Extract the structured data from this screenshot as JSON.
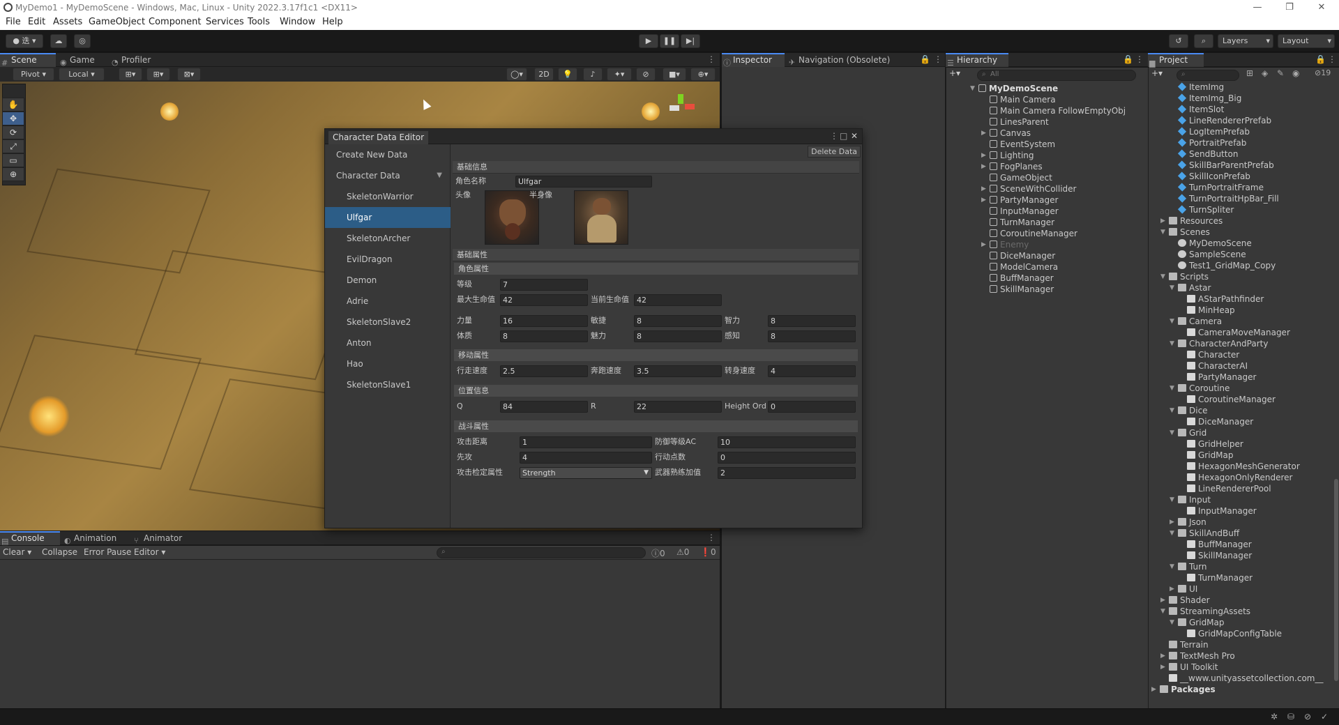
{
  "window": {
    "title": "MyDemo1 - MyDemoScene - Windows, Mac, Linux - Unity 2022.3.17f1c1 <DX11>"
  },
  "menu": [
    "File",
    "Edit",
    "Assets",
    "GameObject",
    "Component",
    "Services",
    "Tools",
    "Window",
    "Help"
  ],
  "toolbar": {
    "account_label": "迭",
    "layers_label": "Layers",
    "layout_label": "Layout"
  },
  "scene_tabs": [
    {
      "label": "Scene"
    },
    {
      "label": "Game"
    },
    {
      "label": "Profiler"
    }
  ],
  "scene_tools": {
    "pivot_label": "Pivot",
    "local_label": "Local",
    "mode_2d": "2D"
  },
  "inspector_tabs": [
    {
      "label": "Inspector"
    },
    {
      "label": "Navigation (Obsolete)"
    }
  ],
  "hierarchy": {
    "tab_label": "Hierarchy",
    "search_placeholder": "All",
    "scene": "MyDemoScene",
    "items": [
      {
        "label": "Main Camera",
        "expandable": false
      },
      {
        "label": "Main Camera FollowEmptyObj",
        "expandable": false
      },
      {
        "label": "LinesParent",
        "expandable": false
      },
      {
        "label": "Canvas",
        "expandable": true
      },
      {
        "label": "EventSystem",
        "expandable": false
      },
      {
        "label": "Lighting",
        "expandable": true
      },
      {
        "label": "FogPlanes",
        "expandable": true
      },
      {
        "label": "GameObject",
        "expandable": false
      },
      {
        "label": "SceneWithCollider",
        "expandable": true
      },
      {
        "label": "PartyManager",
        "expandable": true
      },
      {
        "label": "InputManager",
        "expandable": false
      },
      {
        "label": "TurnManager",
        "expandable": false
      },
      {
        "label": "CoroutineManager",
        "expandable": false
      },
      {
        "label": "Enemy",
        "expandable": true,
        "disabled": true
      },
      {
        "label": "DiceManager",
        "expandable": false
      },
      {
        "label": "ModelCamera",
        "expandable": false
      },
      {
        "label": "BuffManager",
        "expandable": false
      },
      {
        "label": "SkillManager",
        "expandable": false
      }
    ]
  },
  "project": {
    "tab_label": "Project",
    "hidden_count": "19",
    "items": [
      {
        "label": "ItemImg",
        "type": "prefab",
        "indent": 2
      },
      {
        "label": "ItemImg_Big",
        "type": "prefab",
        "indent": 2
      },
      {
        "label": "ItemSlot",
        "type": "prefab",
        "indent": 2
      },
      {
        "label": "LineRendererPrefab",
        "type": "prefab",
        "indent": 2
      },
      {
        "label": "LogItemPrefab",
        "type": "prefab",
        "indent": 2
      },
      {
        "label": "PortraitPrefab",
        "type": "prefab",
        "indent": 2
      },
      {
        "label": "SendButton",
        "type": "prefab",
        "indent": 2
      },
      {
        "label": "SkillBarParentPrefab",
        "type": "prefab",
        "indent": 2
      },
      {
        "label": "SkillIconPrefab",
        "type": "prefab",
        "indent": 2
      },
      {
        "label": "TurnPortraitFrame",
        "type": "prefab",
        "indent": 2
      },
      {
        "label": "TurnPortraitHpBar_Fill",
        "type": "prefab",
        "indent": 2
      },
      {
        "label": "TurnSpliter",
        "type": "prefab",
        "indent": 2
      },
      {
        "label": "Resources",
        "type": "folder",
        "indent": 1,
        "arrow": "▶"
      },
      {
        "label": "Scenes",
        "type": "folder",
        "indent": 1,
        "arrow": "▼"
      },
      {
        "label": "MyDemoScene",
        "type": "scene",
        "indent": 2
      },
      {
        "label": "SampleScene",
        "type": "scene",
        "indent": 2
      },
      {
        "label": "Test1_GridMap_Copy",
        "type": "scene",
        "indent": 2
      },
      {
        "label": "Scripts",
        "type": "folder",
        "indent": 1,
        "arrow": "▼"
      },
      {
        "label": "Astar",
        "type": "folder",
        "indent": 2,
        "arrow": "▼"
      },
      {
        "label": "AStarPathfinder",
        "type": "script",
        "indent": 3
      },
      {
        "label": "MinHeap",
        "type": "script",
        "indent": 3
      },
      {
        "label": "Camera",
        "type": "folder",
        "indent": 2,
        "arrow": "▼"
      },
      {
        "label": "CameraMoveManager",
        "type": "script",
        "indent": 3
      },
      {
        "label": "CharacterAndParty",
        "type": "folder",
        "indent": 2,
        "arrow": "▼"
      },
      {
        "label": "Character",
        "type": "script",
        "indent": 3
      },
      {
        "label": "CharacterAI",
        "type": "script",
        "indent": 3
      },
      {
        "label": "PartyManager",
        "type": "script",
        "indent": 3
      },
      {
        "label": "Coroutine",
        "type": "folder",
        "indent": 2,
        "arrow": "▼"
      },
      {
        "label": "CoroutineManager",
        "type": "script",
        "indent": 3
      },
      {
        "label": "Dice",
        "type": "folder",
        "indent": 2,
        "arrow": "▼"
      },
      {
        "label": "DiceManager",
        "type": "script",
        "indent": 3
      },
      {
        "label": "Grid",
        "type": "folder",
        "indent": 2,
        "arrow": "▼"
      },
      {
        "label": "GridHelper",
        "type": "script",
        "indent": 3
      },
      {
        "label": "GridMap",
        "type": "script",
        "indent": 3
      },
      {
        "label": "HexagonMeshGenerator",
        "type": "script",
        "indent": 3
      },
      {
        "label": "HexagonOnlyRenderer",
        "type": "script",
        "indent": 3
      },
      {
        "label": "LineRendererPool",
        "type": "script",
        "indent": 3
      },
      {
        "label": "Input",
        "type": "folder",
        "indent": 2,
        "arrow": "▼"
      },
      {
        "label": "InputManager",
        "type": "script",
        "indent": 3
      },
      {
        "label": "Json",
        "type": "folder",
        "indent": 2,
        "arrow": "▶"
      },
      {
        "label": "SkillAndBuff",
        "type": "folder",
        "indent": 2,
        "arrow": "▼"
      },
      {
        "label": "BuffManager",
        "type": "script",
        "indent": 3
      },
      {
        "label": "SkillManager",
        "type": "script",
        "indent": 3
      },
      {
        "label": "Turn",
        "type": "folder",
        "indent": 2,
        "arrow": "▼"
      },
      {
        "label": "TurnManager",
        "type": "script",
        "indent": 3
      },
      {
        "label": "UI",
        "type": "folder",
        "indent": 2,
        "arrow": "▶"
      },
      {
        "label": "Shader",
        "type": "folder",
        "indent": 1,
        "arrow": "▶"
      },
      {
        "label": "StreamingAssets",
        "type": "folder",
        "indent": 1,
        "arrow": "▼"
      },
      {
        "label": "GridMap",
        "type": "folder",
        "indent": 2,
        "arrow": "▼"
      },
      {
        "label": "GridMapConfigTable",
        "type": "script",
        "indent": 3
      },
      {
        "label": "Terrain",
        "type": "folder",
        "indent": 1
      },
      {
        "label": "TextMesh Pro",
        "type": "folder",
        "indent": 1,
        "arrow": "▶"
      },
      {
        "label": "UI Toolkit",
        "type": "folder",
        "indent": 1,
        "arrow": "▶"
      },
      {
        "label": "__www.unityassetcollection.com__",
        "type": "script",
        "indent": 1
      },
      {
        "label": "Packages",
        "type": "folder",
        "indent": 0,
        "arrow": "▶",
        "bold": true
      }
    ]
  },
  "bottom_tabs": [
    {
      "label": "Console"
    },
    {
      "label": "Animation"
    },
    {
      "label": "Animator"
    }
  ],
  "console": {
    "clear": "Clear",
    "collapse": "Collapse",
    "error_pause": "Error Pause",
    "editor": "Editor",
    "count_log": "0",
    "count_warn": "0",
    "count_err": "0"
  },
  "editor_window": {
    "title": "Character Data Editor",
    "create_label": "Create New Data",
    "list_header": "Character Data",
    "delete_label": "Delete Data",
    "characters": [
      "SkeletonWarrior",
      "Ulfgar",
      "SkeletonArcher",
      "EvilDragon",
      "Demon",
      "Adrie",
      "SkeletonSlave2",
      "Anton",
      "Hao",
      "SkeletonSlave1"
    ],
    "selected_index": 1,
    "basic": {
      "section": "基础信息",
      "name_label": "角色名称",
      "name_value": "Ulfgar",
      "avatar_label": "头像",
      "halfbody_label": "半身像"
    },
    "attrs": {
      "section": "基础属性",
      "role_section": "角色属性",
      "level_label": "等级",
      "level": "7",
      "maxhp_label": "最大生命值",
      "maxhp": "42",
      "curhp_label": "当前生命值",
      "curhp": "42",
      "str_label": "力量",
      "str": "16",
      "dex_label": "敏捷",
      "dex": "8",
      "int_label": "智力",
      "int": "8",
      "con_label": "体质",
      "con": "8",
      "cha_label": "魅力",
      "cha": "8",
      "wis_label": "感知",
      "wis": "8",
      "move_section": "移动属性",
      "walk_label": "行走速度",
      "walk": "2.5",
      "run_label": "奔跑速度",
      "run": "3.5",
      "turn_label": "转身速度",
      "turn": "4",
      "pos_section": "位置信息",
      "q_label": "Q",
      "q": "84",
      "r_label": "R",
      "r": "22",
      "h_label": "Height Ord",
      "h": "0",
      "combat_section": "战斗属性",
      "range_label": "攻击距离",
      "range": "1",
      "ac_label": "防御等级AC",
      "ac": "10",
      "init_label": "先攻",
      "init": "4",
      "ap_label": "行动点数",
      "ap": "0",
      "check_label": "攻击检定属性",
      "check": "Strength",
      "prof_label": "武器熟练加值",
      "prof": "2"
    }
  }
}
